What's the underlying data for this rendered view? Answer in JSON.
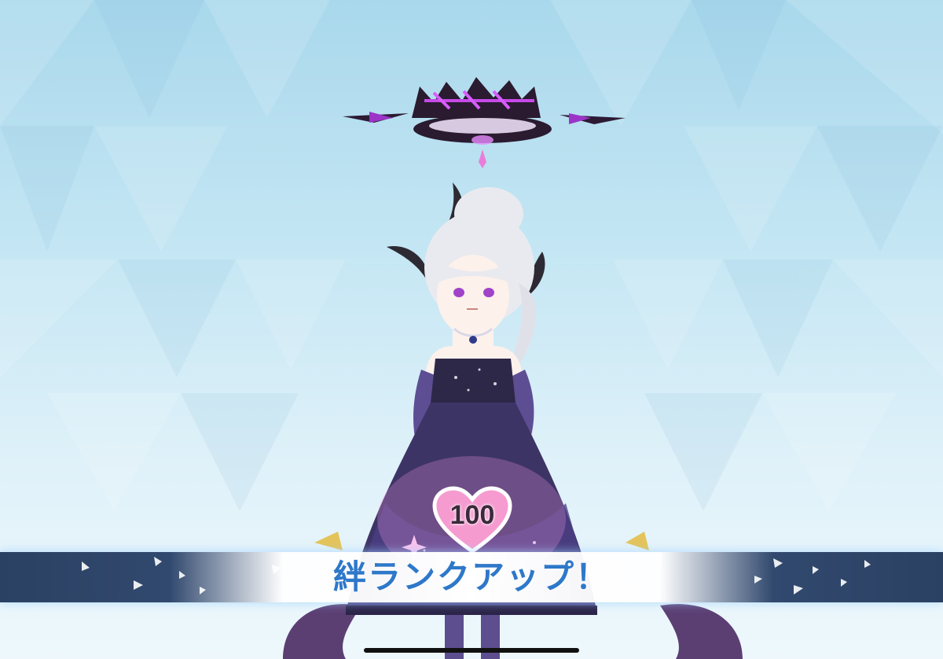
{
  "screen": {
    "name": "bond-rank-up"
  },
  "colors": {
    "sky_top": "#a9d8ec",
    "sky_bottom": "#eef8fc",
    "banner_dark": "#2b4163",
    "banner_text": "#2e78c9",
    "heart": "#f08fc8",
    "halo": "#b43adf"
  },
  "bond": {
    "rank": "100",
    "icon": "heart-icon"
  },
  "banner": {
    "text": "絆ランクアップ！"
  },
  "character": {
    "icon": "character-portrait"
  }
}
